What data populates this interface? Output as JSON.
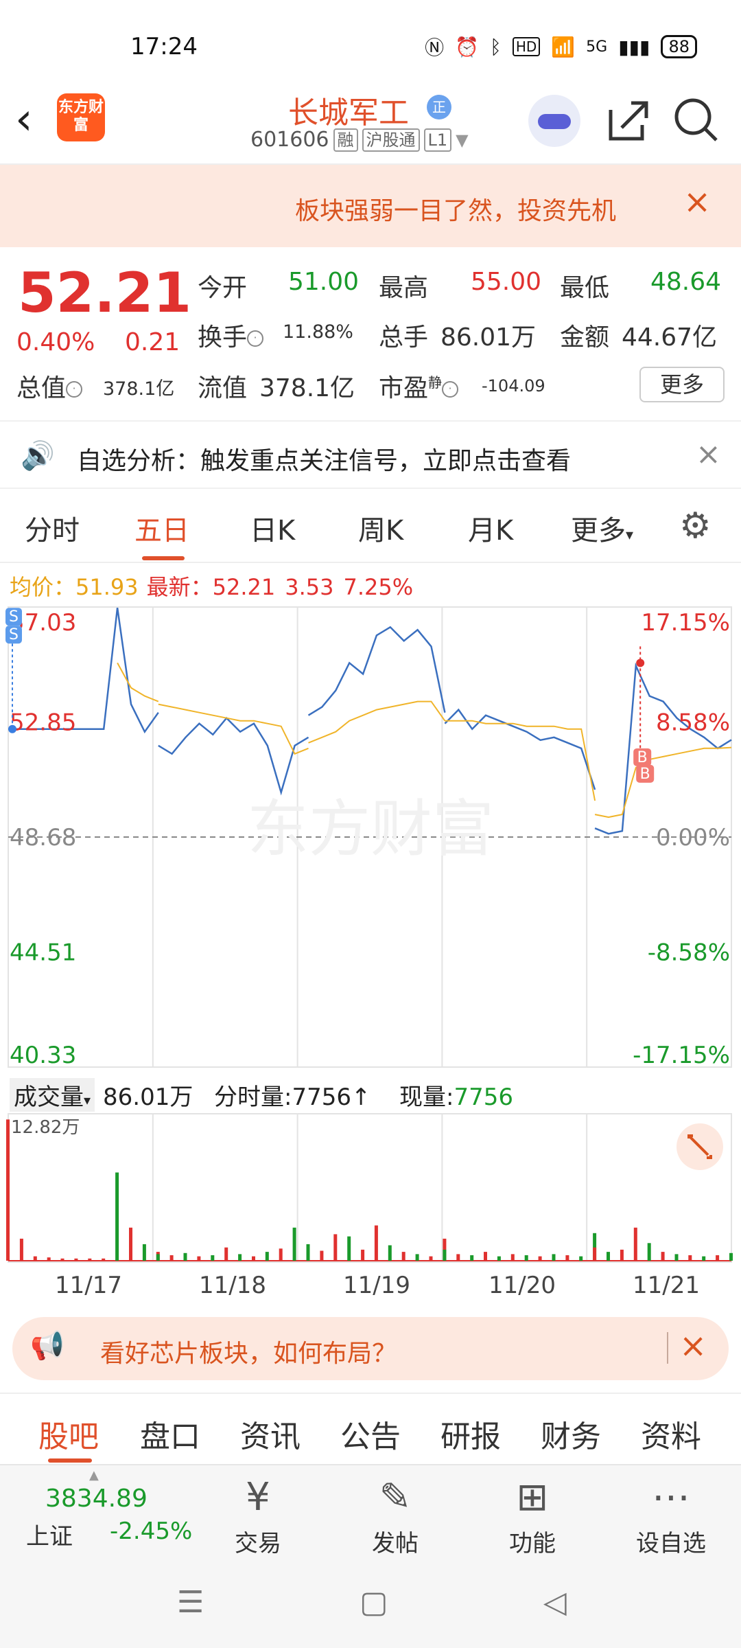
{
  "status_bar": {
    "time": "17:24",
    "network": "5G",
    "battery": "88"
  },
  "header": {
    "logo_text": "东方财富",
    "stock_name": "长城军工",
    "badge": "正",
    "code": "601606",
    "tags": [
      "融",
      "沪股通",
      "L1"
    ]
  },
  "promo_banner": {
    "text": "板块强弱一目了然，投资先机"
  },
  "quote": {
    "price": "52.21",
    "change_pct": "0.40%",
    "change": "0.21",
    "open_label": "今开",
    "open": "51.00",
    "high_label": "最高",
    "high": "55.00",
    "low_label": "最低",
    "low": "48.64",
    "turnover_label": "换手",
    "turnover": "11.88%",
    "volume_label": "总手",
    "volume": "86.01万",
    "amount_label": "金额",
    "amount": "44.67亿",
    "mktcap_label": "总值",
    "mktcap": "378.1亿",
    "float_label": "流值",
    "float_cap": "378.1亿",
    "pe_label": "市盈",
    "pe_sup": "静",
    "pe": "-104.09",
    "more_label": "更多"
  },
  "analysis_bar": {
    "text": "自选分析：触发重点关注信号，立即点击查看"
  },
  "tabs": [
    "分时",
    "五日",
    "日K",
    "周K",
    "月K",
    "更多"
  ],
  "active_tab": "五日",
  "legend": {
    "avg_label": "均价：",
    "avg": "51.93",
    "latest_label": "最新：",
    "latest": "52.21",
    "latest_chg": "3.53",
    "latest_pct": "7.25%"
  },
  "chart_data": {
    "type": "line",
    "title": "",
    "y_labels_left": [
      "57.03",
      "52.85",
      "48.68",
      "44.51",
      "40.33"
    ],
    "y_labels_right": [
      "17.15%",
      "8.58%",
      "0.00%",
      "-8.58%",
      "-17.15%"
    ],
    "ylim": [
      40.33,
      57.03
    ],
    "baseline": 48.68,
    "x_categories": [
      "11/17",
      "11/18",
      "11/19",
      "11/20",
      "11/21"
    ],
    "series": [
      {
        "values": [
          52.6,
          52.6,
          52.6,
          52.6,
          52.6,
          52.6,
          52.6,
          52.6,
          57.0,
          53.5,
          52.5,
          53.2,
          52.0,
          51.7,
          52.3,
          52.8,
          52.4,
          53.0,
          52.5,
          52.8,
          52.0,
          50.3,
          52.0,
          52.3,
          53.1,
          53.4,
          54.0,
          55.0,
          54.6,
          56.0,
          56.3,
          55.8,
          56.2,
          55.6,
          53.2,
          52.8,
          53.3,
          52.6,
          53.1,
          52.9,
          52.7,
          52.5,
          52.2,
          52.3,
          52.1,
          51.9,
          50.4,
          49.0,
          48.8,
          48.9,
          54.9,
          53.8,
          53.6,
          53.0,
          52.6,
          52.3,
          51.9,
          52.21
        ]
      },
      {
        "name": "均价",
        "values": [
          null,
          null,
          null,
          null,
          null,
          null,
          null,
          null,
          55.0,
          54.1,
          53.8,
          53.6,
          53.5,
          53.4,
          53.3,
          53.2,
          53.1,
          53.0,
          52.9,
          52.9,
          52.8,
          52.7,
          51.7,
          51.9,
          52.1,
          52.3,
          52.5,
          52.9,
          53.1,
          53.3,
          53.4,
          53.5,
          53.6,
          53.6,
          52.9,
          52.9,
          52.9,
          52.9,
          52.8,
          52.8,
          52.8,
          52.7,
          52.7,
          52.7,
          52.6,
          52.6,
          50.0,
          49.5,
          49.4,
          49.5,
          51.2,
          51.5,
          51.6,
          51.7,
          51.8,
          51.9,
          51.9,
          51.93
        ]
      }
    ],
    "volume": {
      "max_label": "12.82万",
      "bars": [
        12.8,
        2.0,
        0.4,
        0.3,
        0.2,
        0.2,
        0.2,
        0.2,
        8.0,
        3.0,
        1.5,
        0.8,
        0.6,
        0.5,
        0.7,
        0.4,
        0.5,
        1.2,
        0.6,
        0.4,
        0.8,
        1.1,
        3.0,
        1.2,
        1.5,
        0.9,
        2.4,
        2.2,
        1.0,
        3.2,
        1.4,
        0.8,
        0.6,
        0.4,
        2.0,
        1.0,
        0.6,
        0.5,
        0.8,
        0.4,
        0.6,
        0.5,
        0.4,
        0.6,
        0.5,
        0.4,
        2.5,
        1.2,
        0.8,
        1.0,
        3.0,
        1.6,
        0.8,
        0.6,
        0.5,
        0.4,
        0.5,
        0.7
      ],
      "colors": [
        "red",
        "red",
        "red",
        "red",
        "red",
        "red",
        "red",
        "red",
        "green",
        "red",
        "green",
        "red",
        "green",
        "red",
        "green",
        "red",
        "green",
        "red",
        "green",
        "red",
        "green",
        "red",
        "green",
        "red",
        "green",
        "red",
        "red",
        "green",
        "red",
        "red",
        "green",
        "red",
        "green",
        "red",
        "red",
        "green",
        "red",
        "green",
        "red",
        "green",
        "red",
        "green",
        "red",
        "green",
        "red",
        "green",
        "green",
        "red",
        "green",
        "red",
        "red",
        "green",
        "red",
        "green",
        "red",
        "green",
        "red",
        "green"
      ]
    },
    "colors": {
      "price": "#3a6fbf",
      "avg": "#f0b429",
      "up": "#e0312f",
      "down": "#1a9a2b"
    },
    "markers": {
      "buy": "B",
      "sell": "S"
    },
    "watermark": "东方财富"
  },
  "volume_header": {
    "label": "成交量",
    "value": "86.01万",
    "minute_label": "分时量:",
    "minute_value": "7756",
    "arrow": "↑",
    "now_label": "现量:",
    "now_value": "7756"
  },
  "chip_banner": {
    "text": "看好芯片板块，如何布局？"
  },
  "subtabs": [
    "股吧",
    "盘口",
    "资讯",
    "公告",
    "研报",
    "财务",
    "资料"
  ],
  "active_subtab": "股吧",
  "bottom_bar": {
    "index_value": "3834.89",
    "index_name": "上证",
    "index_change": "-2.45%",
    "items": [
      "交易",
      "发帖",
      "功能",
      "设自选"
    ]
  }
}
